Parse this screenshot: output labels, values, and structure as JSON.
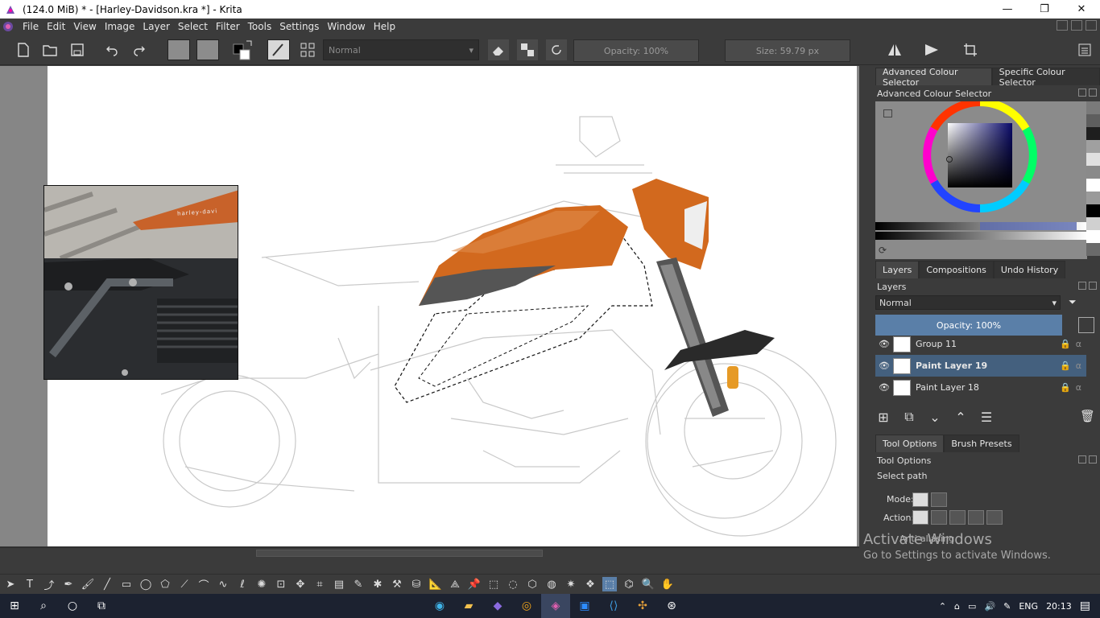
{
  "window": {
    "title": "(124.0 MiB)  * - [Harley-Davidson.kra *] - Krita",
    "minimize": "—",
    "restore": "❐",
    "close": "✕"
  },
  "menu": [
    "File",
    "Edit",
    "View",
    "Image",
    "Layer",
    "Select",
    "Filter",
    "Tools",
    "Settings",
    "Window",
    "Help"
  ],
  "toolbar": {
    "blend_mode": "Normal",
    "opacity_label": "Opacity: 100%",
    "size_label": "Size: 59.79 px"
  },
  "docker": {
    "colour_tabs": [
      "Advanced Colour Selector",
      "Specific Colour Selector"
    ],
    "colour_panel_title": "Advanced Colour Selector",
    "layer_tabs": [
      "Layers",
      "Compositions",
      "Undo History"
    ],
    "layers_title": "Layers",
    "layer_blend": "Normal",
    "layer_opacity": "Opacity:  100%",
    "layers": [
      {
        "name": "Group 11",
        "selected": false
      },
      {
        "name": "Paint Layer 19",
        "selected": true
      },
      {
        "name": "Paint Layer 18",
        "selected": false
      }
    ],
    "tool_tabs": [
      "Tool Options",
      "Brush Presets"
    ],
    "tool_options_title": "Tool Options",
    "tool_subtitle": "Select path",
    "mode_label": "Mode:",
    "action_label": "Action:",
    "antialias_label": "Anti-aliasing"
  },
  "swatch_colors": [
    "#7a7a7a",
    "#5e5e5e",
    "#1e1e1e",
    "#a0a0a0",
    "#e0e0e0",
    "#8a8a8a",
    "#ffffff",
    "#9a9a9a",
    "#000000",
    "#d0d0d0",
    "#ffffff",
    "#6a6a6a"
  ],
  "watermark": {
    "line1": "Activate Windows",
    "line2": "Go to Settings to activate Windows."
  },
  "reference_image_text": "harley-davi",
  "taskbar": {
    "language": "ENG",
    "time": "20:13"
  },
  "colors": {
    "accent": "#5a7fa8",
    "tank_orange": "#d2691e",
    "background": "#3b3b3b"
  }
}
